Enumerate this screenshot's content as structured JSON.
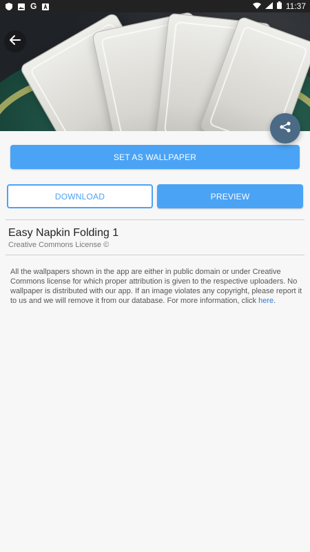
{
  "status_bar": {
    "time": "11:37",
    "left_icons": [
      "shield-icon",
      "image-icon",
      "google-icon",
      "font-a-icon"
    ],
    "right_icons": [
      "wifi-icon",
      "signal-icon",
      "battery-icon"
    ]
  },
  "hero": {
    "description_icons": [
      "back-arrow-icon",
      "share-icon"
    ]
  },
  "actions": {
    "set_wallpaper": "SET AS WALLPAPER",
    "download": "DOWNLOAD",
    "preview": "PREVIEW"
  },
  "wallpaper": {
    "title": "Easy Napkin Folding 1",
    "license": "Creative Commons License ©"
  },
  "disclaimer": {
    "text": "All the wallpapers shown in the app are either in public domain or under Creative Commons license for which proper attribution is given to the respective uploaders. No wallpaper is distributed with our app. If an image violates any copyright, please report it to us and we will remove it from our database. For more information, click ",
    "link_text": "here",
    "end": "."
  },
  "colors": {
    "accent": "#4aa3f5",
    "share_fab": "#4a6a86",
    "link": "#2b7cd3"
  }
}
